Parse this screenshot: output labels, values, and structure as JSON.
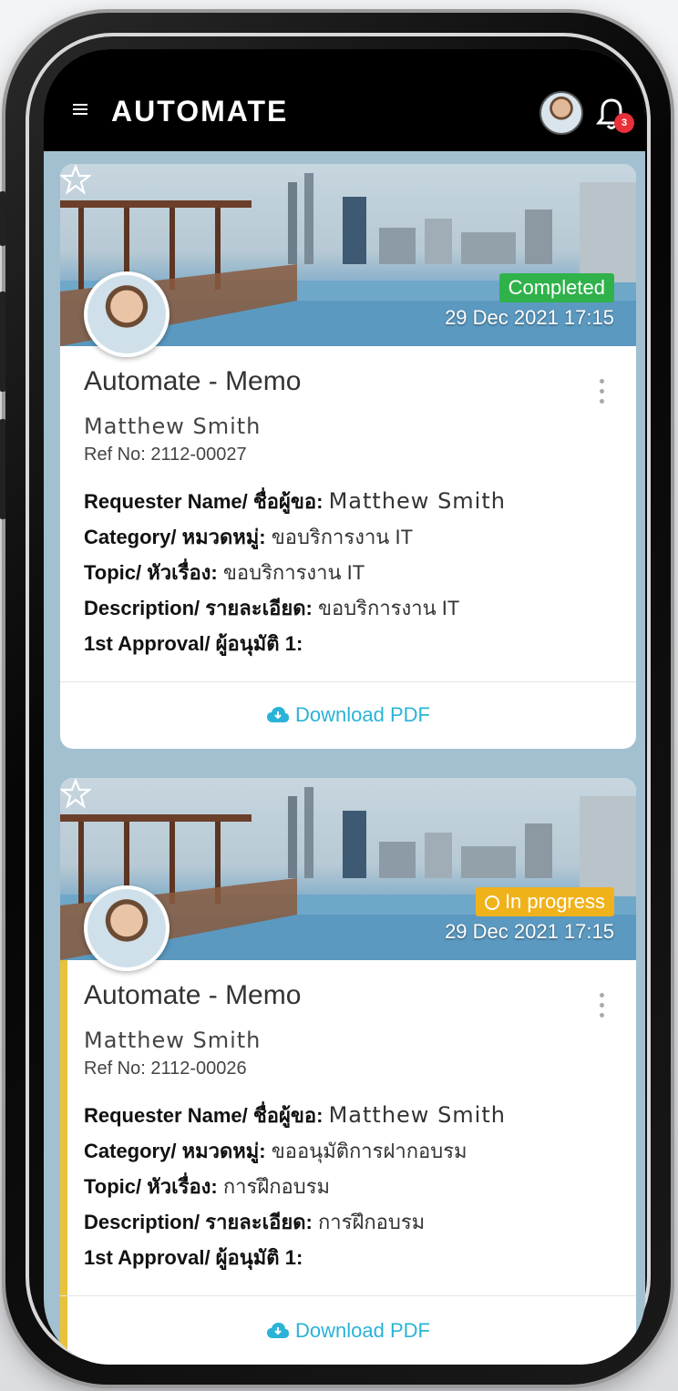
{
  "app": {
    "title": "AUTOMATE",
    "notification_count": "3"
  },
  "cards": [
    {
      "status": "Completed",
      "status_color": "#2fb24a",
      "date": "29 Dec 2021 17:15",
      "form_title": "Automate - Memo",
      "requester": "Matthew Smith",
      "ref": "Ref No: 2112-00027",
      "fields": [
        {
          "label": "Requester Name/ ชื่อผู้ขอ:",
          "value": "Matthew Smith"
        },
        {
          "label": "Category/ หมวดหมู่:",
          "value": "ขอบริการงาน IT"
        },
        {
          "label": "Topic/ หัวเรื่อง:",
          "value": "ขอบริการงาน IT"
        },
        {
          "label": "Description/ รายละเอียด:",
          "value": "ขอบริการงาน IT"
        },
        {
          "label": "1st Approval/ ผู้อนุมัติ 1:",
          "value": ""
        }
      ],
      "download_label": "Download PDF"
    },
    {
      "status": "In progress",
      "status_color": "#f0b21b",
      "date": "29 Dec 2021 17:15",
      "form_title": "Automate - Memo",
      "requester": "Matthew Smith",
      "ref": "Ref No: 2112-00026",
      "fields": [
        {
          "label": "Requester Name/ ชื่อผู้ขอ:",
          "value": "Matthew Smith"
        },
        {
          "label": "Category/ หมวดหมู่:",
          "value": "ขออนุมัติการฝากอบรม"
        },
        {
          "label": "Topic/ หัวเรื่อง:",
          "value": "การฝึกอบรม"
        },
        {
          "label": "Description/ รายละเอียด:",
          "value": "การฝึกอบรม"
        },
        {
          "label": "1st Approval/ ผู้อนุมัติ 1:",
          "value": ""
        }
      ],
      "download_label": "Download PDF"
    }
  ],
  "colors": {
    "accent": "#2ab3d6",
    "completed": "#2fb24a",
    "in_progress": "#f0b21b",
    "badge": "#e8303a"
  },
  "icons": [
    "menu-icon",
    "avatar",
    "bell-icon",
    "star-icon",
    "kebab-menu-icon",
    "cloud-download-icon",
    "clock-icon"
  ]
}
